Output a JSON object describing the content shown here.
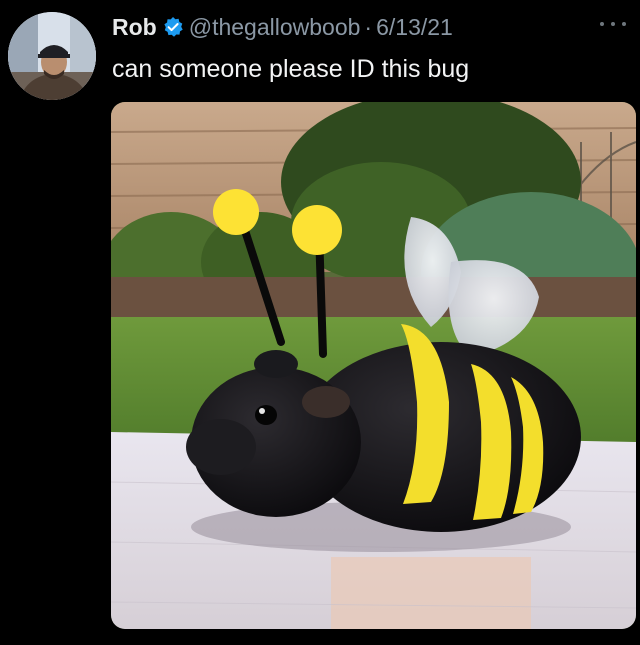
{
  "tweet": {
    "author_name": "Rob",
    "handle": "@thegallowboob",
    "separator": "·",
    "date": "6/13/21",
    "text": "can someone please ID this bug"
  },
  "icons": {
    "verified": "verified-badge-icon",
    "more": "more-options-icon"
  },
  "colors": {
    "background": "#000000",
    "name": "#e7e9ea",
    "secondary_text": "#8b98a5",
    "verified_badge": "#1d9bf0"
  },
  "media": {
    "description_role": "attached-photo"
  }
}
